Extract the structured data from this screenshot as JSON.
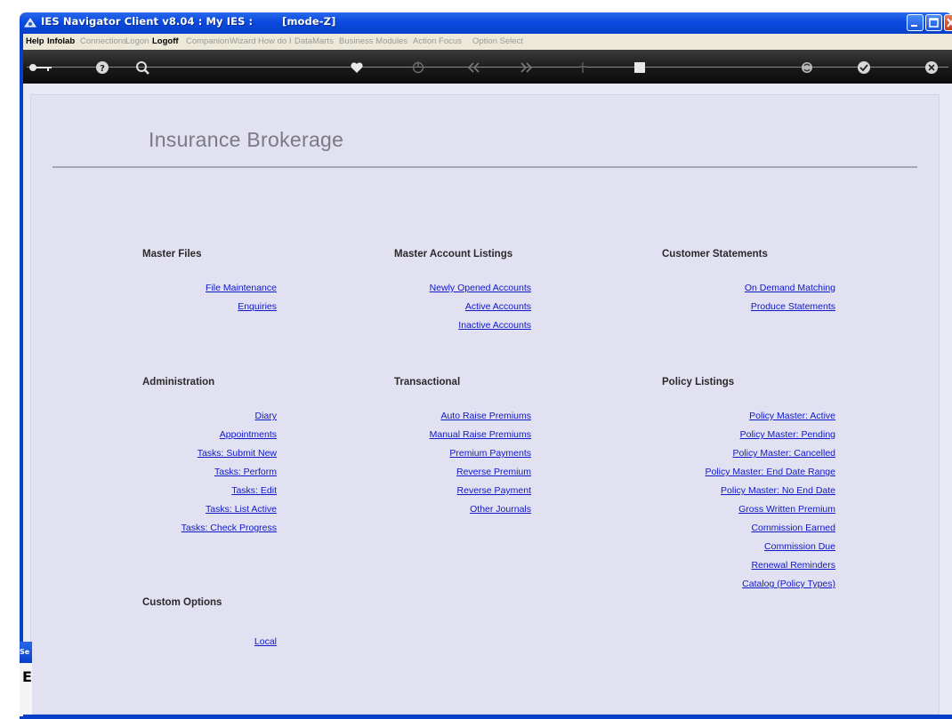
{
  "window": {
    "title": "IES Navigator Client v8.04 : My IES :        [mode-Z]"
  },
  "menu": {
    "items": [
      {
        "label": "Help",
        "enabled": true
      },
      {
        "label": "Infolab",
        "enabled": true
      },
      {
        "label": "Connections",
        "enabled": false
      },
      {
        "label": "Logon",
        "enabled": false
      },
      {
        "label": "Logoff",
        "enabled": true
      },
      {
        "label": "Companion",
        "enabled": false
      },
      {
        "label": "Wizard",
        "enabled": false
      },
      {
        "label": "How do I",
        "enabled": false
      },
      {
        "label": "DataMarts",
        "enabled": false
      },
      {
        "label": "Business Modules",
        "enabled": false
      },
      {
        "label": "Action Focus",
        "enabled": false
      },
      {
        "label": "Option Select",
        "enabled": false
      }
    ]
  },
  "toolbar": {
    "icons": [
      "key-icon",
      "help-icon",
      "search-icon",
      "heart-icon",
      "power-icon",
      "rewind-icon",
      "forward-icon",
      "tree-icon",
      "stop-icon",
      "recycle-icon",
      "check-icon",
      "close-icon"
    ]
  },
  "page": {
    "title": "Insurance Brokerage"
  },
  "sections": {
    "master_files": {
      "heading": "Master Files",
      "links": [
        "File Maintenance",
        "Enquiries"
      ]
    },
    "master_account_listings": {
      "heading": "Master Account Listings",
      "links": [
        "Newly Opened Accounts",
        "Active Accounts",
        "Inactive Accounts"
      ]
    },
    "customer_statements": {
      "heading": "Customer Statements",
      "links": [
        "On Demand Matching",
        "Produce Statements"
      ]
    },
    "administration": {
      "heading": "Administration",
      "links": [
        "Diary",
        "Appointments",
        "Tasks: Submit New",
        "Tasks: Perform",
        "Tasks: Edit",
        "Tasks: List Active",
        "Tasks: Check Progress"
      ]
    },
    "transactional": {
      "heading": "Transactional",
      "links": [
        "Auto Raise Premiums",
        "Manual Raise Premiums",
        "Premium Payments",
        "Reverse Premium",
        "Reverse Payment",
        "Other Journals"
      ]
    },
    "policy_listings": {
      "heading": "Policy Listings",
      "links": [
        "Policy Master: Active",
        "Policy Master: Pending",
        "Policy Master: Cancelled",
        "Policy Master: End Date Range",
        "Policy Master: No End Date",
        "Gross Written Premium",
        "Commission Earned",
        "Commission Due",
        "Renewal Reminders",
        "Catalog (Policy Types)"
      ]
    },
    "custom_options": {
      "heading": "Custom Options",
      "links": [
        "Local"
      ]
    }
  },
  "side_window": {
    "caption": "Se",
    "text": "E"
  },
  "colors": {
    "titlebar": "#0a4ae0",
    "link": "#1018c8",
    "content_bg": "#e1e1f2"
  }
}
